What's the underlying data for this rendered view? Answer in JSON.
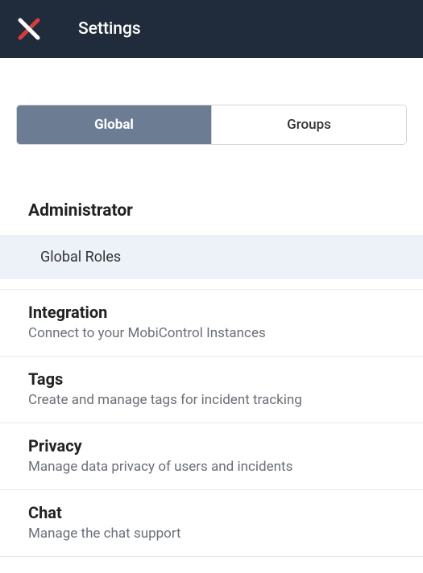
{
  "header": {
    "title": "Settings"
  },
  "tabs": {
    "global": "Global",
    "groups": "Groups"
  },
  "administrator": {
    "title": "Administrator",
    "global_roles": "Global Roles"
  },
  "items": {
    "integration": {
      "title": "Integration",
      "desc": "Connect to your MobiControl Instances"
    },
    "tags": {
      "title": "Tags",
      "desc": "Create and manage tags for incident tracking"
    },
    "privacy": {
      "title": "Privacy",
      "desc": "Manage data privacy of users and incidents"
    },
    "chat": {
      "title": "Chat",
      "desc": "Manage the chat support"
    }
  }
}
